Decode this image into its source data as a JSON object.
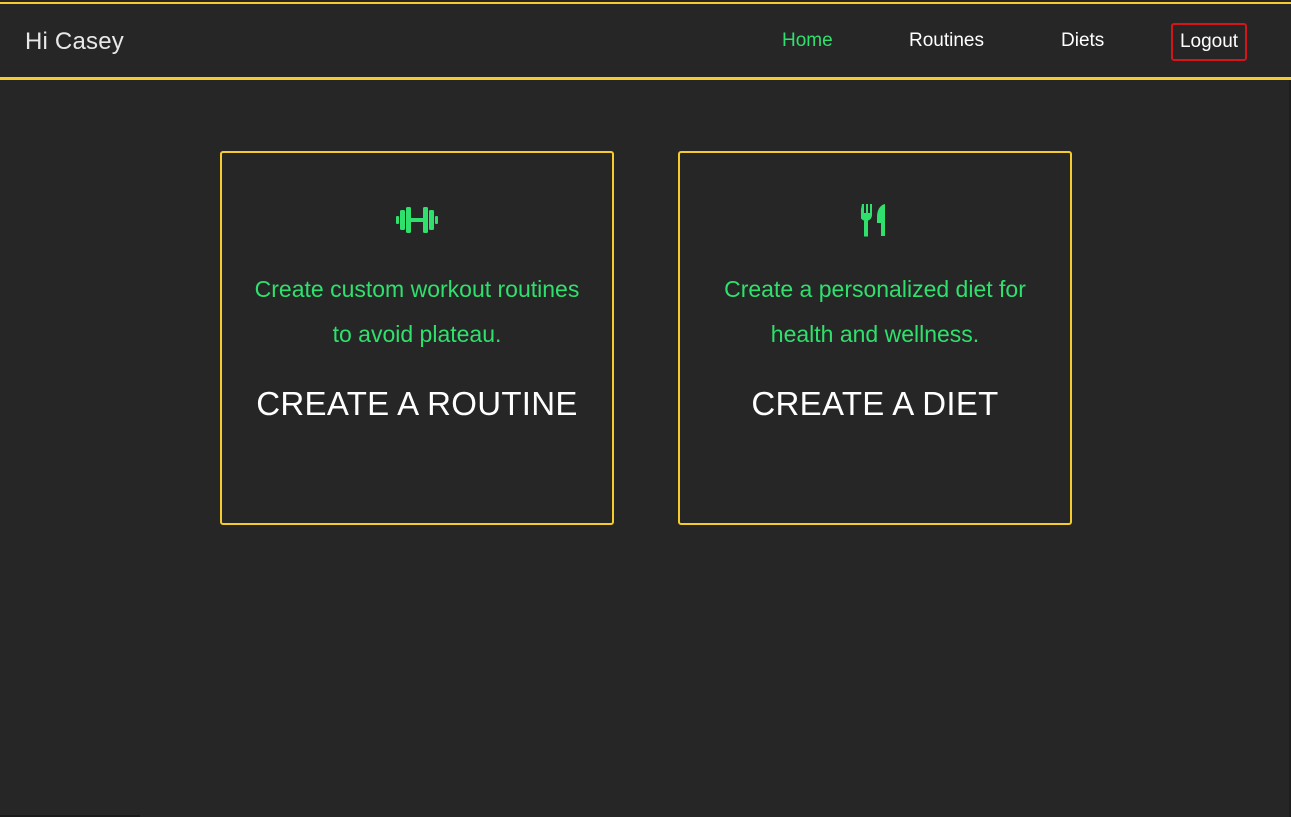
{
  "navbar": {
    "greeting": "Hi Casey",
    "links": {
      "home": "Home",
      "routines": "Routines",
      "diets": "Diets",
      "logout": "Logout"
    }
  },
  "cards": {
    "routine": {
      "icon": "dumbbell-icon",
      "description": "Create custom workout routines to avoid plateau.",
      "title": "CREATE A ROUTINE"
    },
    "diet": {
      "icon": "utensils-icon",
      "description": "Create a personalized diet for health and wellness.",
      "title": "CREATE A DIET"
    }
  },
  "colors": {
    "background": "#262626",
    "accent_yellow": "#f5cc2e",
    "accent_green": "#2fe06d",
    "logout_border": "#d4161b",
    "text": "#ffffff"
  }
}
